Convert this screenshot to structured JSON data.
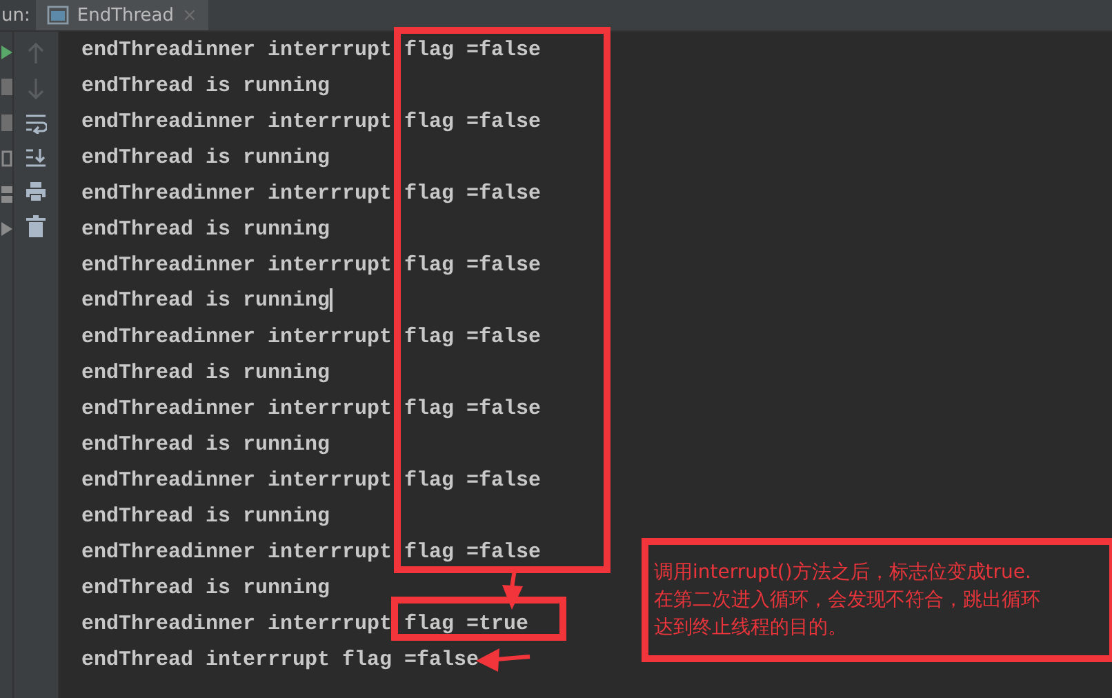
{
  "run_label": "un:",
  "tabs": [
    {
      "title": "EndThread",
      "close": "×",
      "selected": true
    }
  ],
  "console_lines": [
    "endThreadinner interrrupt flag =false",
    "endThread is running",
    "endThreadinner interrrupt flag =false",
    "endThread is running",
    "endThreadinner interrrupt flag =false",
    "endThread is running",
    "endThreadinner interrrupt flag =false",
    "endThread is running",
    "endThreadinner interrrupt flag =false",
    "endThread is running",
    "endThreadinner interrrupt flag =false",
    "endThread is running",
    "endThreadinner interrrupt flag =false",
    "endThread is running",
    "endThreadinner interrrupt flag =false",
    "endThread is running",
    "endThreadinner interrrupt flag =true",
    "endThread interrrupt flag =false"
  ],
  "caret_lines": [
    false,
    false,
    false,
    false,
    false,
    false,
    false,
    true,
    false,
    false,
    false,
    false,
    false,
    false,
    false,
    false,
    false,
    false
  ],
  "annotation": {
    "lines": [
      "调用interrupt()方法之后，标志位变成true.",
      "在第二次进入循环，会发现不符合，跳出循环",
      "达到终止线程的目的。"
    ]
  }
}
